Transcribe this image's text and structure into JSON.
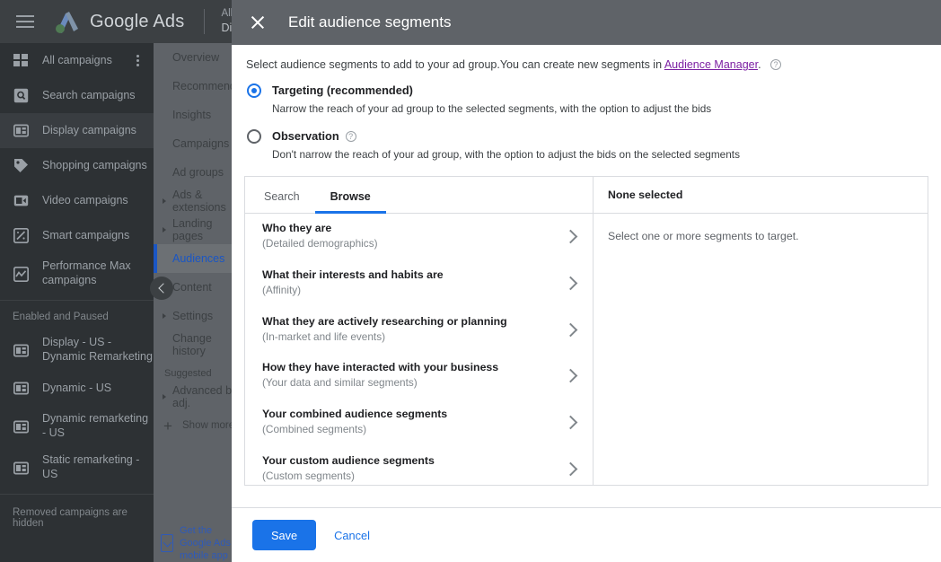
{
  "app": {
    "brand_prefix": "Google",
    "brand_suffix": "Ads",
    "account_line1": "All campaigns",
    "account_line2": "Display campaigns",
    "menu_icon": "hamburger-icon"
  },
  "sidebar": {
    "items": [
      {
        "label": "All campaigns",
        "icon": "grid-icon",
        "selected": false,
        "kebab": true
      },
      {
        "label": "Search campaigns",
        "icon": "search-campaign-icon",
        "selected": false,
        "kebab": false
      },
      {
        "label": "Display campaigns",
        "icon": "display-campaign-icon",
        "selected": true,
        "kebab": false
      },
      {
        "label": "Shopping campaigns",
        "icon": "tag-icon",
        "selected": false,
        "kebab": false
      },
      {
        "label": "Video campaigns",
        "icon": "video-icon",
        "selected": false,
        "kebab": false
      },
      {
        "label": "Smart campaigns",
        "icon": "wand-icon",
        "selected": false,
        "kebab": false
      },
      {
        "label": "Performance Max campaigns",
        "icon": "trend-icon",
        "selected": false,
        "kebab": false
      }
    ],
    "section_header": "Enabled and Paused",
    "campaigns": [
      {
        "label": "Display - US - Dynamic Remarketing",
        "icon": "display-campaign-icon"
      },
      {
        "label": "Dynamic - US",
        "icon": "display-campaign-icon"
      },
      {
        "label": "Dynamic remarketing - US",
        "icon": "display-campaign-icon"
      },
      {
        "label": "Static remarketing - US",
        "icon": "display-campaign-icon"
      }
    ],
    "footnote": "Removed campaigns are hidden"
  },
  "subnav": {
    "items": [
      {
        "label": "Overview",
        "caret": false,
        "selected": false
      },
      {
        "label": "Recommendations",
        "caret": false,
        "selected": false
      },
      {
        "label": "Insights",
        "caret": false,
        "selected": false
      },
      {
        "label": "Campaigns",
        "caret": false,
        "selected": false
      },
      {
        "label": "Ad groups",
        "caret": false,
        "selected": false
      },
      {
        "label": "Ads & extensions",
        "caret": true,
        "selected": false
      },
      {
        "label": "Landing pages",
        "caret": true,
        "selected": false
      },
      {
        "label": "Audiences",
        "caret": false,
        "selected": true
      },
      {
        "label": "Content",
        "caret": true,
        "selected": false
      },
      {
        "label": "Settings",
        "caret": true,
        "selected": false
      },
      {
        "label": "Change history",
        "caret": false,
        "selected": false
      }
    ],
    "suggested_header": "Suggested",
    "suggested_items": [
      {
        "label": "Advanced bid adj.",
        "caret": true
      }
    ],
    "show_more": "Show more",
    "promo": "Get the Google Ads mobile app"
  },
  "modal": {
    "title": "Edit audience segments",
    "close_icon": "close-icon",
    "intro_text": "Select audience segments to add to your ad group.You can create new segments in ",
    "intro_link": "Audience Manager",
    "intro_after": ".",
    "help_icon": "help-icon",
    "options": [
      {
        "label": "Targeting (recommended)",
        "description": "Narrow the reach of your ad group to the selected segments, with the option to adjust the bids",
        "selected": true,
        "has_help": false
      },
      {
        "label": "Observation",
        "description": "Don't narrow the reach of your ad group, with the option to adjust the bids on the selected segments",
        "selected": false,
        "has_help": true
      }
    ],
    "tabs": [
      {
        "label": "Search",
        "active": false
      },
      {
        "label": "Browse",
        "active": true
      }
    ],
    "browse_rows": [
      {
        "title": "Who they are",
        "sub": "(Detailed demographics)"
      },
      {
        "title": "What their interests and habits are",
        "sub": "(Affinity)"
      },
      {
        "title": "What they are actively researching or planning",
        "sub": "(In-market and life events)"
      },
      {
        "title": "How they have interacted with your business",
        "sub": "(Your data and similar segments)"
      },
      {
        "title": "Your combined audience segments",
        "sub": "(Combined segments)"
      },
      {
        "title": "Your custom audience segments",
        "sub": "(Custom segments)"
      }
    ],
    "selection_header": "None selected",
    "selection_empty": "Select one or more segments to target.",
    "save_label": "Save",
    "cancel_label": "Cancel"
  },
  "colors": {
    "accent_blue": "#1a73e8",
    "header_gray": "#5f6368",
    "sidebar_dark": "#2d3134",
    "link_purple": "#7b1fa2"
  }
}
